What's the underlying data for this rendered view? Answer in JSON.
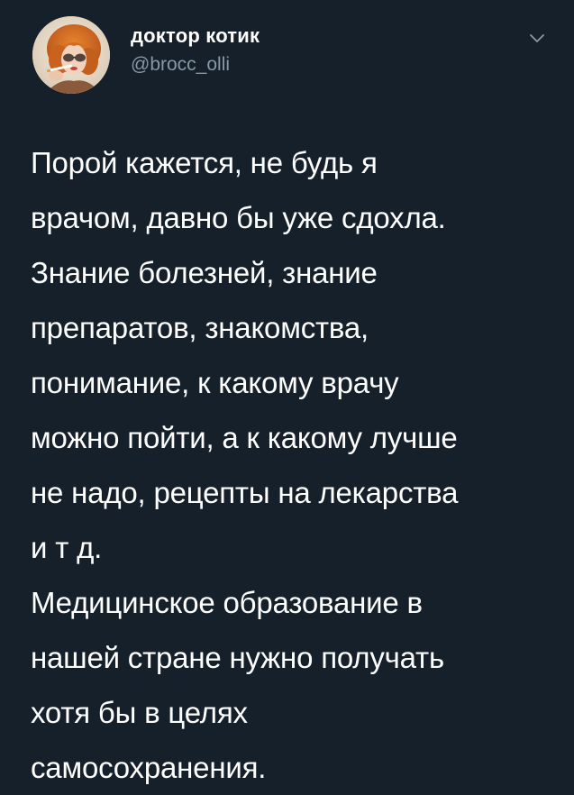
{
  "tweet": {
    "author": {
      "display_name": "доктор котик",
      "handle": "@brocc_olli",
      "avatar_icon": "profile-photo"
    },
    "menu_icon": "chevron-down-icon",
    "lines": [
      "Порой кажется, не будь я",
      "врачом, давно бы уже сдохла.",
      "Знание болезней, знание",
      "препаратов, знакомства,",
      "понимание, к какому врачу",
      "можно пойти, а к какому лучше",
      "не надо, рецепты на лекарства",
      "и т д.",
      "Медицинское образование в",
      "нашей стране нужно получать",
      "хотя бы в целях",
      "самосохранения."
    ]
  },
  "colors": {
    "background": "#15202b",
    "text_primary": "#ffffff",
    "text_secondary": "#8899a6"
  }
}
